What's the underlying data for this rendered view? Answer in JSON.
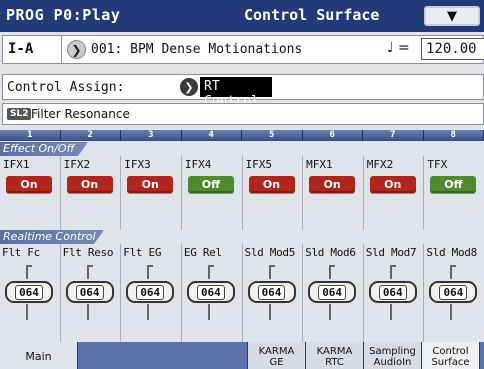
{
  "header": {
    "mode_title": "PROG P0:Play",
    "page_title": "Control Surface",
    "menu_icon": "chevron-down-icon"
  },
  "program": {
    "bank": "I-A",
    "name": "001: BPM Dense Motionations",
    "tempo_symbol": "♩ =",
    "tempo": "120.00"
  },
  "control_assign": {
    "label": "Control Assign:",
    "value": "RT Control"
  },
  "slider_info": {
    "tag": "SL2",
    "text": "Filter Resonance"
  },
  "columns": [
    "1",
    "2",
    "3",
    "4",
    "5",
    "6",
    "7",
    "8"
  ],
  "effect_section": {
    "label": "Effect On/Off",
    "items": [
      {
        "name": "IFX1",
        "state": "On"
      },
      {
        "name": "IFX2",
        "state": "On"
      },
      {
        "name": "IFX3",
        "state": "On"
      },
      {
        "name": "IFX4",
        "state": "Off"
      },
      {
        "name": "IFX5",
        "state": "On"
      },
      {
        "name": "MFX1",
        "state": "On"
      },
      {
        "name": "MFX2",
        "state": "On"
      },
      {
        "name": "TFX",
        "state": "Off"
      }
    ]
  },
  "realtime_section": {
    "label": "Realtime Control",
    "items": [
      {
        "name": "Flt Fc",
        "value": "064"
      },
      {
        "name": "Flt Reso",
        "value": "064"
      },
      {
        "name": "Flt EG",
        "value": "064"
      },
      {
        "name": "EG Rel",
        "value": "064"
      },
      {
        "name": "Sld Mod5",
        "value": "064"
      },
      {
        "name": "Sld Mod6",
        "value": "064"
      },
      {
        "name": "Sld Mod7",
        "value": "064"
      },
      {
        "name": "Sld Mod8",
        "value": "064"
      }
    ]
  },
  "tabs": {
    "main": "Main",
    "karma_ge_1": "KARMA",
    "karma_ge_2": "GE",
    "karma_rtc_1": "KARMA",
    "karma_rtc_2": "RTC",
    "sampling_1": "Sampling",
    "sampling_2": "AudioIn",
    "control_1": "Control",
    "control_2": "Surface"
  },
  "colors": {
    "on": "#b0261c",
    "off": "#4e8a2e",
    "header": "#223a7a"
  }
}
